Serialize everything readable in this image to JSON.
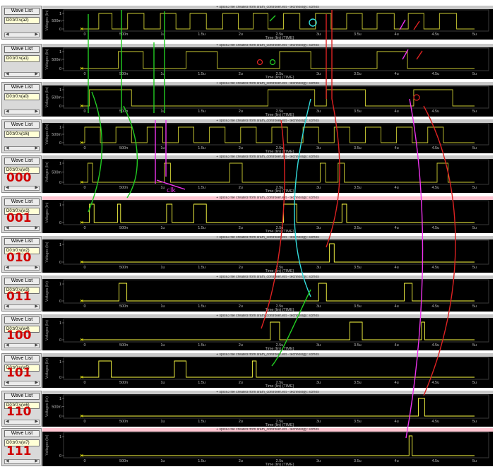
{
  "ui": {
    "wave_list_label": "Wave List",
    "plot_title": "+ spice3 file created from sram_controller.ext - technology: scmos",
    "y_axis_label": "Voltages (lin)",
    "x_axis_label": "Time (lin) (TIME)",
    "time_ticks": [
      "0",
      "500n",
      "1u",
      "1.5u",
      "2u",
      "2.5u",
      "3u",
      "3.5u",
      "4u",
      "4.5u",
      "5u"
    ],
    "volt_ticks_a": [
      "1",
      "500m",
      "0"
    ],
    "volt_ticks_b": [
      "1",
      "0"
    ],
    "clk_annotation": "clk"
  },
  "colors": {
    "trace": "#cccc33",
    "trace_bright": "#ffff44",
    "plot_bg": "#000000",
    "annot_green": "#22cc22",
    "annot_red": "#dd2222",
    "annot_cyan": "#33dddd",
    "annot_magenta": "#ee33ee"
  },
  "panels": [
    {
      "signal": "D0:tr0:v(a2)",
      "annotation": "",
      "pink": false,
      "ticks": "a",
      "high": [
        [
          0.18,
          0.35
        ],
        [
          0.55,
          0.76
        ],
        [
          0.97,
          1.17
        ],
        [
          1.35,
          1.56
        ],
        [
          1.77,
          1.97
        ],
        [
          2.16,
          2.35
        ],
        [
          2.55,
          2.76
        ],
        [
          2.96,
          3.16
        ],
        [
          3.36,
          3.56
        ],
        [
          3.75,
          3.97
        ],
        [
          4.15,
          4.35
        ],
        [
          4.55,
          4.77
        ]
      ]
    },
    {
      "signal": "D0:tr0:v(a1)",
      "annotation": "",
      "pink": false,
      "ticks": "a",
      "high": [
        [
          0.43,
          0.75
        ],
        [
          1.3,
          1.7
        ],
        [
          2.5,
          2.9
        ],
        [
          3.75,
          4.14
        ]
      ]
    },
    {
      "signal": "D0:tr0:v(a0)",
      "annotation": "",
      "pink": false,
      "ticks": "a",
      "high": [
        [
          0.06,
          0.6
        ],
        [
          2.35,
          2.95
        ],
        [
          3.1,
          3.6
        ],
        [
          4.22,
          4.72
        ]
      ]
    },
    {
      "signal": "D0:tr0:v(clk)",
      "annotation": "",
      "pink": false,
      "ticks": "a",
      "high": [
        [
          0.0,
          0.2
        ],
        [
          0.4,
          0.6
        ],
        [
          0.8,
          1.0
        ],
        [
          1.2,
          1.4
        ],
        [
          1.6,
          1.8
        ],
        [
          2.0,
          2.2
        ],
        [
          2.4,
          2.6
        ],
        [
          2.8,
          3.0
        ],
        [
          3.2,
          3.4
        ],
        [
          3.6,
          3.8
        ],
        [
          4.0,
          4.2
        ],
        [
          4.4,
          4.6
        ]
      ]
    },
    {
      "signal": "D0:tr0:v(w0)",
      "annotation": "000",
      "pink": false,
      "ticks": "a",
      "high": [
        [
          0.04,
          0.1
        ],
        [
          1.02,
          1.1
        ],
        [
          1.86,
          2.02
        ],
        [
          3.02,
          3.09
        ],
        [
          3.25,
          3.33
        ],
        [
          4.52,
          4.66
        ]
      ]
    },
    {
      "signal": "D0:tr0:v(w1)",
      "annotation": "001",
      "pink": true,
      "ticks": "b",
      "high": [
        [
          0.06,
          0.12
        ],
        [
          0.42,
          0.46
        ],
        [
          1.05,
          1.12
        ],
        [
          1.4,
          1.56
        ],
        [
          2.55,
          2.72
        ],
        [
          3.3,
          3.36
        ]
      ]
    },
    {
      "signal": "D0:tr0:v(w2)",
      "annotation": "010",
      "pink": false,
      "ticks": "b",
      "high": [
        [
          3.14,
          3.2
        ]
      ]
    },
    {
      "signal": "D0:tr0:v(w3)",
      "annotation": "011",
      "pink": false,
      "ticks": "b",
      "high": [
        [
          0.44,
          0.54
        ],
        [
          3.0,
          3.1
        ],
        [
          4.1,
          4.2
        ]
      ]
    },
    {
      "signal": "D0:tr0:v(w4)",
      "annotation": "100",
      "pink": false,
      "ticks": "b",
      "high": [
        [
          2.38,
          2.5
        ],
        [
          3.4,
          3.56
        ],
        [
          4.32,
          4.36
        ]
      ]
    },
    {
      "signal": "D0:tr0:v(w5)",
      "annotation": "101",
      "pink": false,
      "ticks": "b",
      "high": [
        [
          0.18,
          0.34
        ],
        [
          1.15,
          1.3
        ],
        [
          2.15,
          2.2
        ]
      ]
    },
    {
      "signal": "D0:tr0:v(w6)",
      "annotation": "110",
      "pink": false,
      "ticks": "a",
      "high": [
        [
          4.28,
          4.36
        ]
      ]
    },
    {
      "signal": "D0:tr0:v(w7)",
      "annotation": "111",
      "pink": true,
      "ticks": "b",
      "high": [
        [
          4.16,
          4.2
        ]
      ]
    }
  ]
}
